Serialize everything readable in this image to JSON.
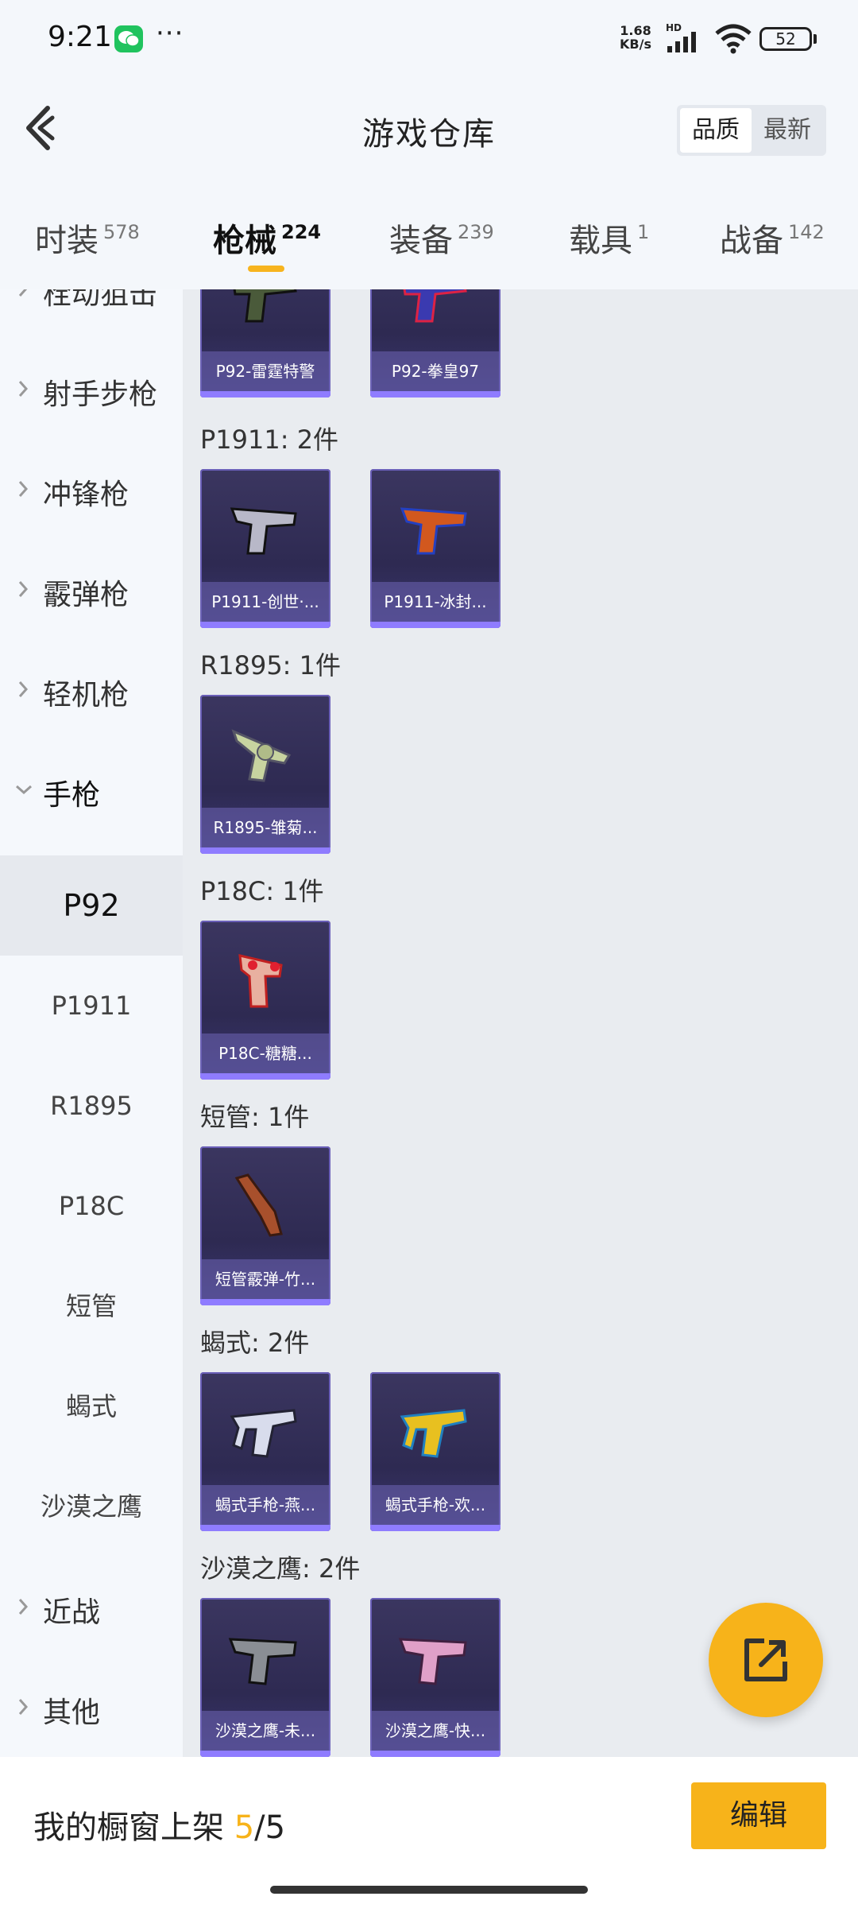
{
  "status_bar": {
    "time": "9:21",
    "net_speed_value": "1.68",
    "net_speed_unit": "KB/s",
    "network_label": "HD",
    "battery": "52"
  },
  "header": {
    "title": "游戏仓库",
    "sort_options": [
      "品质",
      "最新"
    ]
  },
  "tabs": [
    {
      "label": "时装",
      "count": "578"
    },
    {
      "label": "枪械",
      "count": "224"
    },
    {
      "label": "装备",
      "count": "239"
    },
    {
      "label": "载具",
      "count": "1"
    },
    {
      "label": "战备",
      "count": "142"
    }
  ],
  "sidebar": {
    "categories_top": [
      "栓动狙击",
      "射手步枪",
      "冲锋枪",
      "霰弹枪",
      "轻机枪"
    ],
    "expanded_category": "手枪",
    "subcategories": [
      "P92",
      "P1911",
      "R1895",
      "P18C",
      "短管",
      "蝎式",
      "沙漠之鹰"
    ],
    "categories_bottom": [
      "近战",
      "其他"
    ]
  },
  "main": {
    "groups": [
      {
        "title": "",
        "items": [
          "P92-雷霆特警",
          "P92-拳皇97"
        ]
      },
      {
        "title": "P1911: 2件",
        "items": [
          "P1911-创世·...",
          "P1911-冰封..."
        ]
      },
      {
        "title": "R1895: 1件",
        "items": [
          "R1895-雏菊..."
        ]
      },
      {
        "title": "P18C: 1件",
        "items": [
          "P18C-糖糖..."
        ]
      },
      {
        "title": "短管: 1件",
        "items": [
          "短管霰弹-竹..."
        ]
      },
      {
        "title": "蝎式: 2件",
        "items": [
          "蝎式手枪-燕...",
          "蝎式手枪-欢..."
        ]
      },
      {
        "title": "沙漠之鹰: 2件",
        "items": [
          "沙漠之鹰-未...",
          "沙漠之鹰-快..."
        ]
      }
    ]
  },
  "bottom": {
    "showcase_label": "我的橱窗上架",
    "showcase_current": "5",
    "showcase_total": "/5",
    "edit_label": "编辑"
  },
  "colors": {
    "accent": "#f7b31a",
    "card_bg": "#2e2a52",
    "card_label_bg": "#6e64b4"
  }
}
